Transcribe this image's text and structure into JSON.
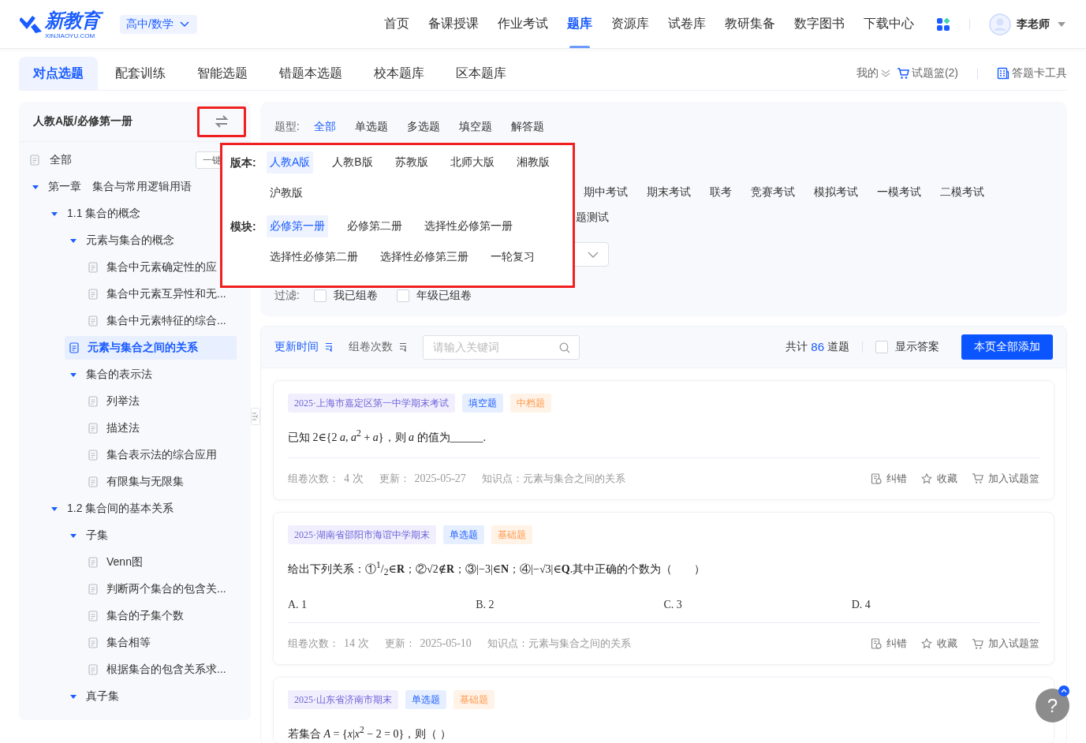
{
  "header": {
    "logo": {
      "name": "新教育",
      "domain": "XINJIAOYU.COM"
    },
    "subject": "高中/数学",
    "nav": [
      {
        "label": "首页",
        "selected": false
      },
      {
        "label": "备课授课",
        "selected": false
      },
      {
        "label": "作业考试",
        "selected": false
      },
      {
        "label": "题库",
        "selected": true
      },
      {
        "label": "资源库",
        "selected": false
      },
      {
        "label": "试卷库",
        "selected": false
      },
      {
        "label": "教研集备",
        "selected": false
      },
      {
        "label": "数字图书",
        "selected": false
      },
      {
        "label": "下载中心",
        "selected": false
      }
    ],
    "user": "李老师"
  },
  "subtabs": {
    "tabs": [
      {
        "label": "对点选题",
        "selected": true
      },
      {
        "label": "配套训练",
        "selected": false
      },
      {
        "label": "智能选题",
        "selected": false
      },
      {
        "label": "错题本选题",
        "selected": false
      },
      {
        "label": "校本题库",
        "selected": false
      },
      {
        "label": "区本题库",
        "selected": false
      }
    ],
    "mine": "我的",
    "basket": "试题篮(2)",
    "card_tool": "答题卡工具"
  },
  "sidebar": {
    "title": "人教A版/必修第一册",
    "all": {
      "label": "全部",
      "button": "一键"
    },
    "tree": [
      {
        "label": "第一章　集合与常用逻辑用语",
        "kind": "branch",
        "expanded": true,
        "selected": false,
        "children": [
          {
            "label": "1.1 集合的概念",
            "kind": "branch",
            "expanded": true,
            "selected": false,
            "children": [
              {
                "label": "元素与集合的概念",
                "kind": "branch",
                "expanded": true,
                "selected": false,
                "children": [
                  {
                    "label": "集合中元素确定性的应",
                    "kind": "leaf",
                    "selected": false
                  },
                  {
                    "label": "集合中元素互异性和无...",
                    "kind": "leaf",
                    "selected": false
                  },
                  {
                    "label": "集合中元素特征的综合...",
                    "kind": "leaf",
                    "selected": false
                  }
                ]
              },
              {
                "label": "元素与集合之间的关系",
                "kind": "leaf",
                "selected": true
              },
              {
                "label": "集合的表示法",
                "kind": "branch",
                "expanded": true,
                "selected": false,
                "children": [
                  {
                    "label": "列举法",
                    "kind": "leaf",
                    "selected": false
                  },
                  {
                    "label": "描述法",
                    "kind": "leaf",
                    "selected": false
                  },
                  {
                    "label": "集合表示法的综合应用",
                    "kind": "leaf",
                    "selected": false
                  },
                  {
                    "label": "有限集与无限集",
                    "kind": "leaf",
                    "selected": false
                  }
                ]
              }
            ]
          },
          {
            "label": "1.2 集合间的基本关系",
            "kind": "branch",
            "expanded": true,
            "selected": false,
            "children": [
              {
                "label": "子集",
                "kind": "branch",
                "expanded": true,
                "selected": false,
                "children": [
                  {
                    "label": "Venn图",
                    "kind": "leaf",
                    "selected": false
                  },
                  {
                    "label": "判断两个集合的包含关...",
                    "kind": "leaf",
                    "selected": false
                  },
                  {
                    "label": "集合的子集个数",
                    "kind": "leaf",
                    "selected": false
                  },
                  {
                    "label": "集合相等",
                    "kind": "leaf",
                    "selected": false
                  },
                  {
                    "label": "根据集合的包含关系求...",
                    "kind": "leaf",
                    "selected": false
                  }
                ]
              },
              {
                "label": "真子集",
                "kind": "branch",
                "expanded": true,
                "selected": false
              }
            ]
          }
        ]
      }
    ]
  },
  "filters": {
    "type_row": {
      "label": "题型:",
      "options": [
        {
          "label": "全部",
          "selected": true
        },
        {
          "label": "单选题",
          "selected": false
        },
        {
          "label": "多选题",
          "selected": false
        },
        {
          "label": "填空题",
          "selected": false
        },
        {
          "label": "解答题",
          "selected": false
        }
      ]
    },
    "exam_options": [
      "期中考试",
      "期末考试",
      "联考",
      "竞赛考试",
      "模拟考试",
      "一模考试",
      "二模考试"
    ],
    "partial_option": "题测试",
    "filter_row": {
      "label": "过滤:",
      "options": [
        {
          "label": "我已组卷",
          "checked": false
        },
        {
          "label": "年级已组卷",
          "checked": false
        }
      ]
    }
  },
  "popup": {
    "version": {
      "label": "版本:",
      "options": [
        {
          "label": "人教A版",
          "selected": true
        },
        {
          "label": "人教B版",
          "selected": false
        },
        {
          "label": "苏教版",
          "selected": false
        },
        {
          "label": "北师大版",
          "selected": false
        },
        {
          "label": "湘教版",
          "selected": false
        },
        {
          "label": "沪教版",
          "selected": false
        }
      ]
    },
    "module": {
      "label": "模块:",
      "options": [
        {
          "label": "必修第一册",
          "selected": true
        },
        {
          "label": "必修第二册",
          "selected": false
        },
        {
          "label": "选择性必修第一册",
          "selected": false
        },
        {
          "label": "选择性必修第二册",
          "selected": false
        },
        {
          "label": "选择性必修第三册",
          "selected": false
        },
        {
          "label": "一轮复习",
          "selected": false
        }
      ]
    }
  },
  "list": {
    "sort": [
      {
        "label": "更新时间",
        "selected": true
      },
      {
        "label": "组卷次数",
        "selected": false
      }
    ],
    "search": {
      "placeholder": "请输入关键词"
    },
    "total": {
      "prefix": "共计",
      "count": "86",
      "suffix": "道题"
    },
    "show_answer": {
      "label": "显示答案",
      "checked": false
    },
    "add_all": "本页全部添加",
    "questions": [
      {
        "source": "2025·上海市嘉定区第一中学期末考试",
        "type": "填空题",
        "difficulty": "中档题",
        "stem": "已知 2∈{2 *a*, *a*$^{2}$ + *a*}，则 *a* 的值为______.",
        "meta": {
          "count_label": "组卷次数：",
          "count": "4 次",
          "update_label": "更新：",
          "date": "2025-05-27",
          "knowledge": "知识点：元素与集合之间的关系"
        },
        "actions": [
          {
            "kind": "report",
            "label": "纠错"
          },
          {
            "kind": "favorite",
            "label": "收藏"
          },
          {
            "kind": "basket",
            "label": "加入试题篮"
          }
        ]
      },
      {
        "source": "2025·湖南省邵阳市海谊中学期末",
        "type": "单选题",
        "difficulty": "基础题",
        "stem": "给出下列关系：①$^{1}$/$_{2}$∈**R**；②√2∉**R**；③|−3|∈**N**；④|−√3|∈**Q**.其中正确的个数为（　　）",
        "choices": [
          "A. 1",
          "B. 2",
          "C. 3",
          "D. 4"
        ],
        "meta": {
          "count_label": "组卷次数：",
          "count": "14 次",
          "update_label": "更新：",
          "date": "2025-05-10",
          "knowledge": "知识点：元素与集合之间的关系"
        },
        "actions": [
          {
            "kind": "report",
            "label": "纠错"
          },
          {
            "kind": "favorite",
            "label": "收藏"
          },
          {
            "kind": "basket",
            "label": "加入试题篮"
          }
        ]
      },
      {
        "source": "2025·山东省济南市期末",
        "type": "单选题",
        "difficulty": "基础题",
        "stem": "若集合 *A* = {*x*|*x*$^{2}$ − 2 = 0}，则（ ）"
      }
    ]
  },
  "help": "?"
}
